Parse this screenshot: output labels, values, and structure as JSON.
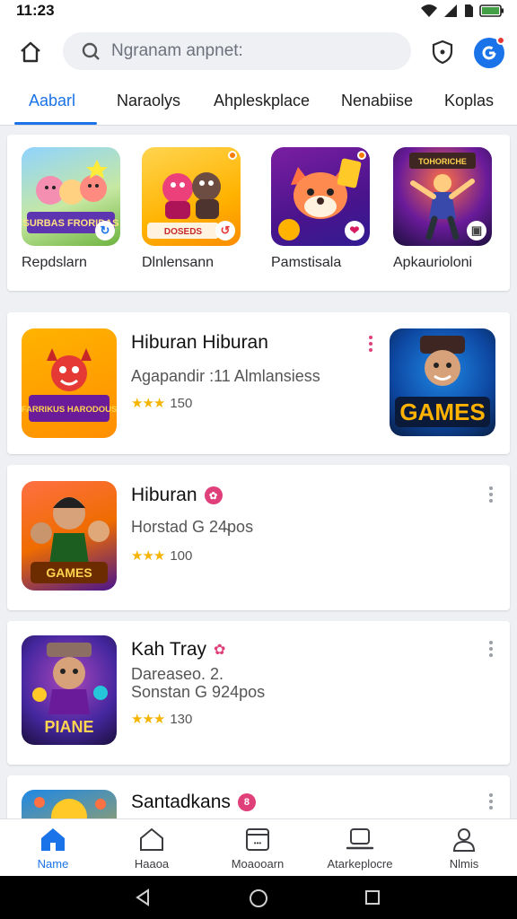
{
  "status_bar": {
    "time": "11:23"
  },
  "search": {
    "placeholder": "Ngranam anpnet:"
  },
  "tabs": [
    {
      "label": "Aabarl",
      "active": true
    },
    {
      "label": "Naraolys"
    },
    {
      "label": "Ahpleskplace"
    },
    {
      "label": "Nenabiise"
    },
    {
      "label": "Koplas"
    }
  ],
  "featured": [
    {
      "name": "Repdslarn",
      "thumb_text": "SURBAS FRORIDAS"
    },
    {
      "name": "Dlnlensann",
      "thumb_text": "DOSEDS"
    },
    {
      "name": "Pamstisala",
      "thumb_text": ""
    },
    {
      "name": "Apkaurioloni",
      "thumb_text": "TOHORICHE"
    }
  ],
  "apps": [
    {
      "title": "Hiburan Hiburan",
      "subtitle": "Agapandir :11 Almlansiess",
      "rating": "150",
      "icon_text": "FARRIKUS HARODOUS",
      "side_text": "GAMES"
    },
    {
      "title": "Hiburan",
      "subtitle": "Horstad G 24̴pos",
      "rating": "100",
      "icon_text": "GAMES"
    },
    {
      "title": "Kah Tray",
      "subtitle": "Dareaseo. 2.",
      "subtitle2": "Sonstan G 924pos",
      "rating": "130",
      "icon_text": "PIANE"
    },
    {
      "title": "Santadkans",
      "badge": "8"
    }
  ],
  "bottom_nav": [
    {
      "label": "Name",
      "icon": "home-icon",
      "active": true
    },
    {
      "label": "Haaoa",
      "icon": "house-outline-icon"
    },
    {
      "label": "Moaooarn",
      "icon": "calendar-icon"
    },
    {
      "label": "Atarkeplocre",
      "icon": "laptop-icon"
    },
    {
      "label": "Nlmis",
      "icon": "person-icon"
    }
  ],
  "colors": {
    "accent": "#1a73e8",
    "star": "#f4b400",
    "pink": "#e0407a",
    "background": "#eef0f3"
  }
}
